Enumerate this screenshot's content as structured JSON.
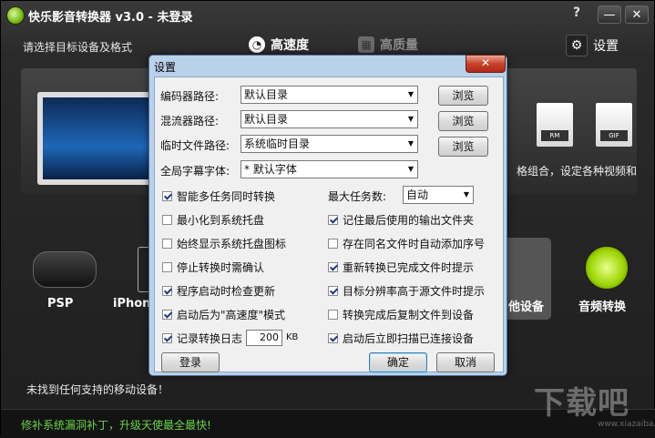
{
  "app": {
    "title": "快乐影音转换器 v3.0 - 未登录",
    "help": "?",
    "minimize": "—",
    "close": "✕",
    "subtitle": "请选择目标设备及格式",
    "mode_fast": "高速度",
    "mode_hq": "高质量",
    "settings": "设置",
    "banner_text": "格组合，设定各种视频和",
    "file_tags": [
      "RM",
      "GIF"
    ],
    "devices": [
      {
        "label": "PSP"
      },
      {
        "label": "iPhone"
      },
      {
        "label": "他设备"
      },
      {
        "label": "音频转换"
      }
    ],
    "status_msg": "未找到任何支持的移动设备！",
    "footer_msg": "修补系统漏洞补丁，升级天使最全最快!",
    "watermark": "下载吧",
    "watermark_url": "www.xiazaiba.com"
  },
  "dialog": {
    "title": "设置",
    "close": "✕",
    "rows": [
      {
        "label": "编码器路径:",
        "value": "默认目录",
        "button": "浏览"
      },
      {
        "label": "混流器路径:",
        "value": "默认目录",
        "button": "浏览"
      },
      {
        "label": "临时文件路径:",
        "value": "系统临时目录",
        "button": "浏览"
      },
      {
        "label": "全局字幕字体:",
        "value": "* 默认字体"
      }
    ],
    "max_tasks_label": "最大任务数:",
    "max_tasks_value": "自动",
    "options_left": [
      {
        "label": "智能多任务同时转换",
        "checked": true
      },
      {
        "label": "最小化到系统托盘",
        "checked": false
      },
      {
        "label": "始终显示系统托盘图标",
        "checked": false
      },
      {
        "label": "停止转换时需确认",
        "checked": false
      },
      {
        "label": "程序启动时检查更新",
        "checked": true
      },
      {
        "label": "启动后为\"高速度\"模式",
        "checked": true
      },
      {
        "label": "记录转换日志",
        "checked": true
      }
    ],
    "options_right": [
      {
        "label": "记住最后使用的输出文件夹",
        "checked": true
      },
      {
        "label": "存在同名文件时自动添加序号",
        "checked": false
      },
      {
        "label": "重新转换已完成文件时提示",
        "checked": true
      },
      {
        "label": "目标分辨率高于源文件时提示",
        "checked": true
      },
      {
        "label": "转换完成后复制文件到设备",
        "checked": false
      },
      {
        "label": "启动后立即扫描已连接设备",
        "checked": true
      }
    ],
    "log_size": "200",
    "log_unit": "KB",
    "login_button": "登录",
    "ok_button": "确定",
    "cancel_button": "取消"
  }
}
